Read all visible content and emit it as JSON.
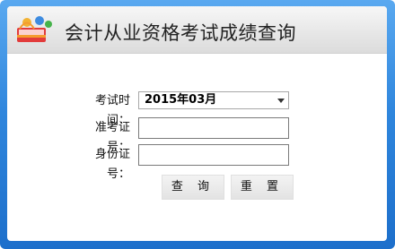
{
  "header": {
    "title": "会计从业资格考试成绩查询",
    "logo_icon": "books-user-icon"
  },
  "form": {
    "exam_time_label": "考试时间：",
    "exam_time_value": "2015年03月",
    "admission_label": "准考证号：",
    "admission_value": "",
    "id_label": "身份证号：",
    "id_value": ""
  },
  "buttons": {
    "query": "查 询",
    "reset": "重 置"
  },
  "colors": {
    "frame": "#2f86dd",
    "header_bg": "#e6e6e6"
  }
}
